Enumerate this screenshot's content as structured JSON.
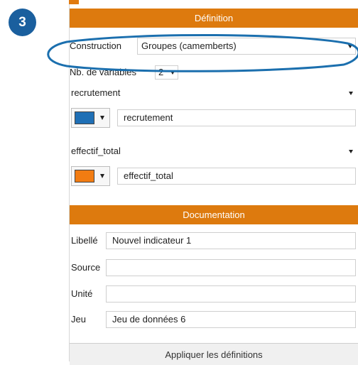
{
  "badge": {
    "number": "3"
  },
  "definition": {
    "header": "Définition",
    "construction_label": "Construction",
    "construction_value": "Groupes (camemberts)",
    "nb_variables_label": "Nb. de variables",
    "nb_variables_value": "2",
    "variable1": {
      "select": "recrutement",
      "name": "recrutement",
      "color": "#1f6fb5"
    },
    "variable2": {
      "select": "effectif_total",
      "name": "effectif_total",
      "color": "#f27c12"
    }
  },
  "documentation": {
    "header": "Documentation",
    "libelle_label": "Libellé",
    "libelle_value": "Nouvel indicateur 1",
    "source_label": "Source",
    "source_value": "",
    "unite_label": "Unité",
    "unite_value": "",
    "jeu_label": "Jeu",
    "jeu_value": "Jeu de données 6"
  },
  "apply_button": "Appliquer les définitions",
  "colors": {
    "header_orange": "#dd7a0e",
    "badge_blue": "#1a5f9e",
    "highlight_blue": "#1b6fae"
  }
}
